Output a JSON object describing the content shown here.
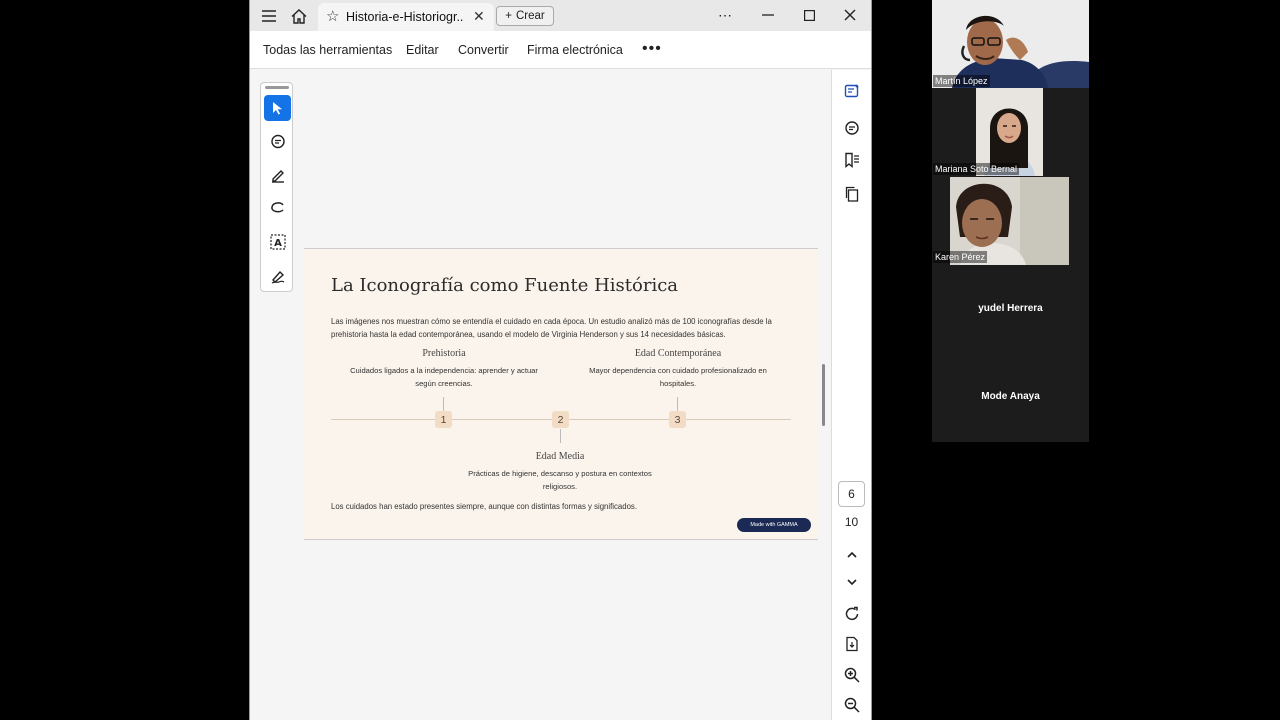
{
  "window": {
    "tab_title": "Historia-e-Historiogr...",
    "create_label": "Crear"
  },
  "menu": {
    "items": [
      "Todas las herramientas",
      "Editar",
      "Convertir",
      "Firma electrónica"
    ]
  },
  "slide": {
    "title": "La Iconografía como Fuente Histórica",
    "intro": "Las imágenes nos muestran cómo se entendía el cuidado en cada época. Un estudio analizó más de 100 iconografías desde la prehistoria hasta la edad contemporánea, usando el modelo de Virginia Henderson y sus 14 necesidades básicas.",
    "timeline": [
      {
        "number": "1",
        "title": "Prehistoria",
        "desc": "Cuidados ligados a la independencia: aprender y actuar según creencias."
      },
      {
        "number": "2",
        "title": "Edad Media",
        "desc": "Prácticas de higiene, descanso y postura en contextos religiosos."
      },
      {
        "number": "3",
        "title": "Edad Contemporánea",
        "desc": "Mayor dependencia con cuidado profesionalizado en hospitales."
      }
    ],
    "footer": "Los cuidados han estado presentes siempre, aunque con distintas formas y significados.",
    "badge": "Made with GAMMA"
  },
  "pager": {
    "current": "6",
    "total": "10"
  },
  "call": {
    "participants": [
      "Martín López",
      "Mariana Soto Bernal",
      "Karen Pérez",
      "yudel Herrera",
      "Mode Anaya"
    ]
  },
  "colors": {
    "accent": "#1473e6",
    "slide_bg": "#fbf4ec",
    "timeline_marker": "#f2dcc6",
    "badge_bg": "#1b2a55"
  }
}
